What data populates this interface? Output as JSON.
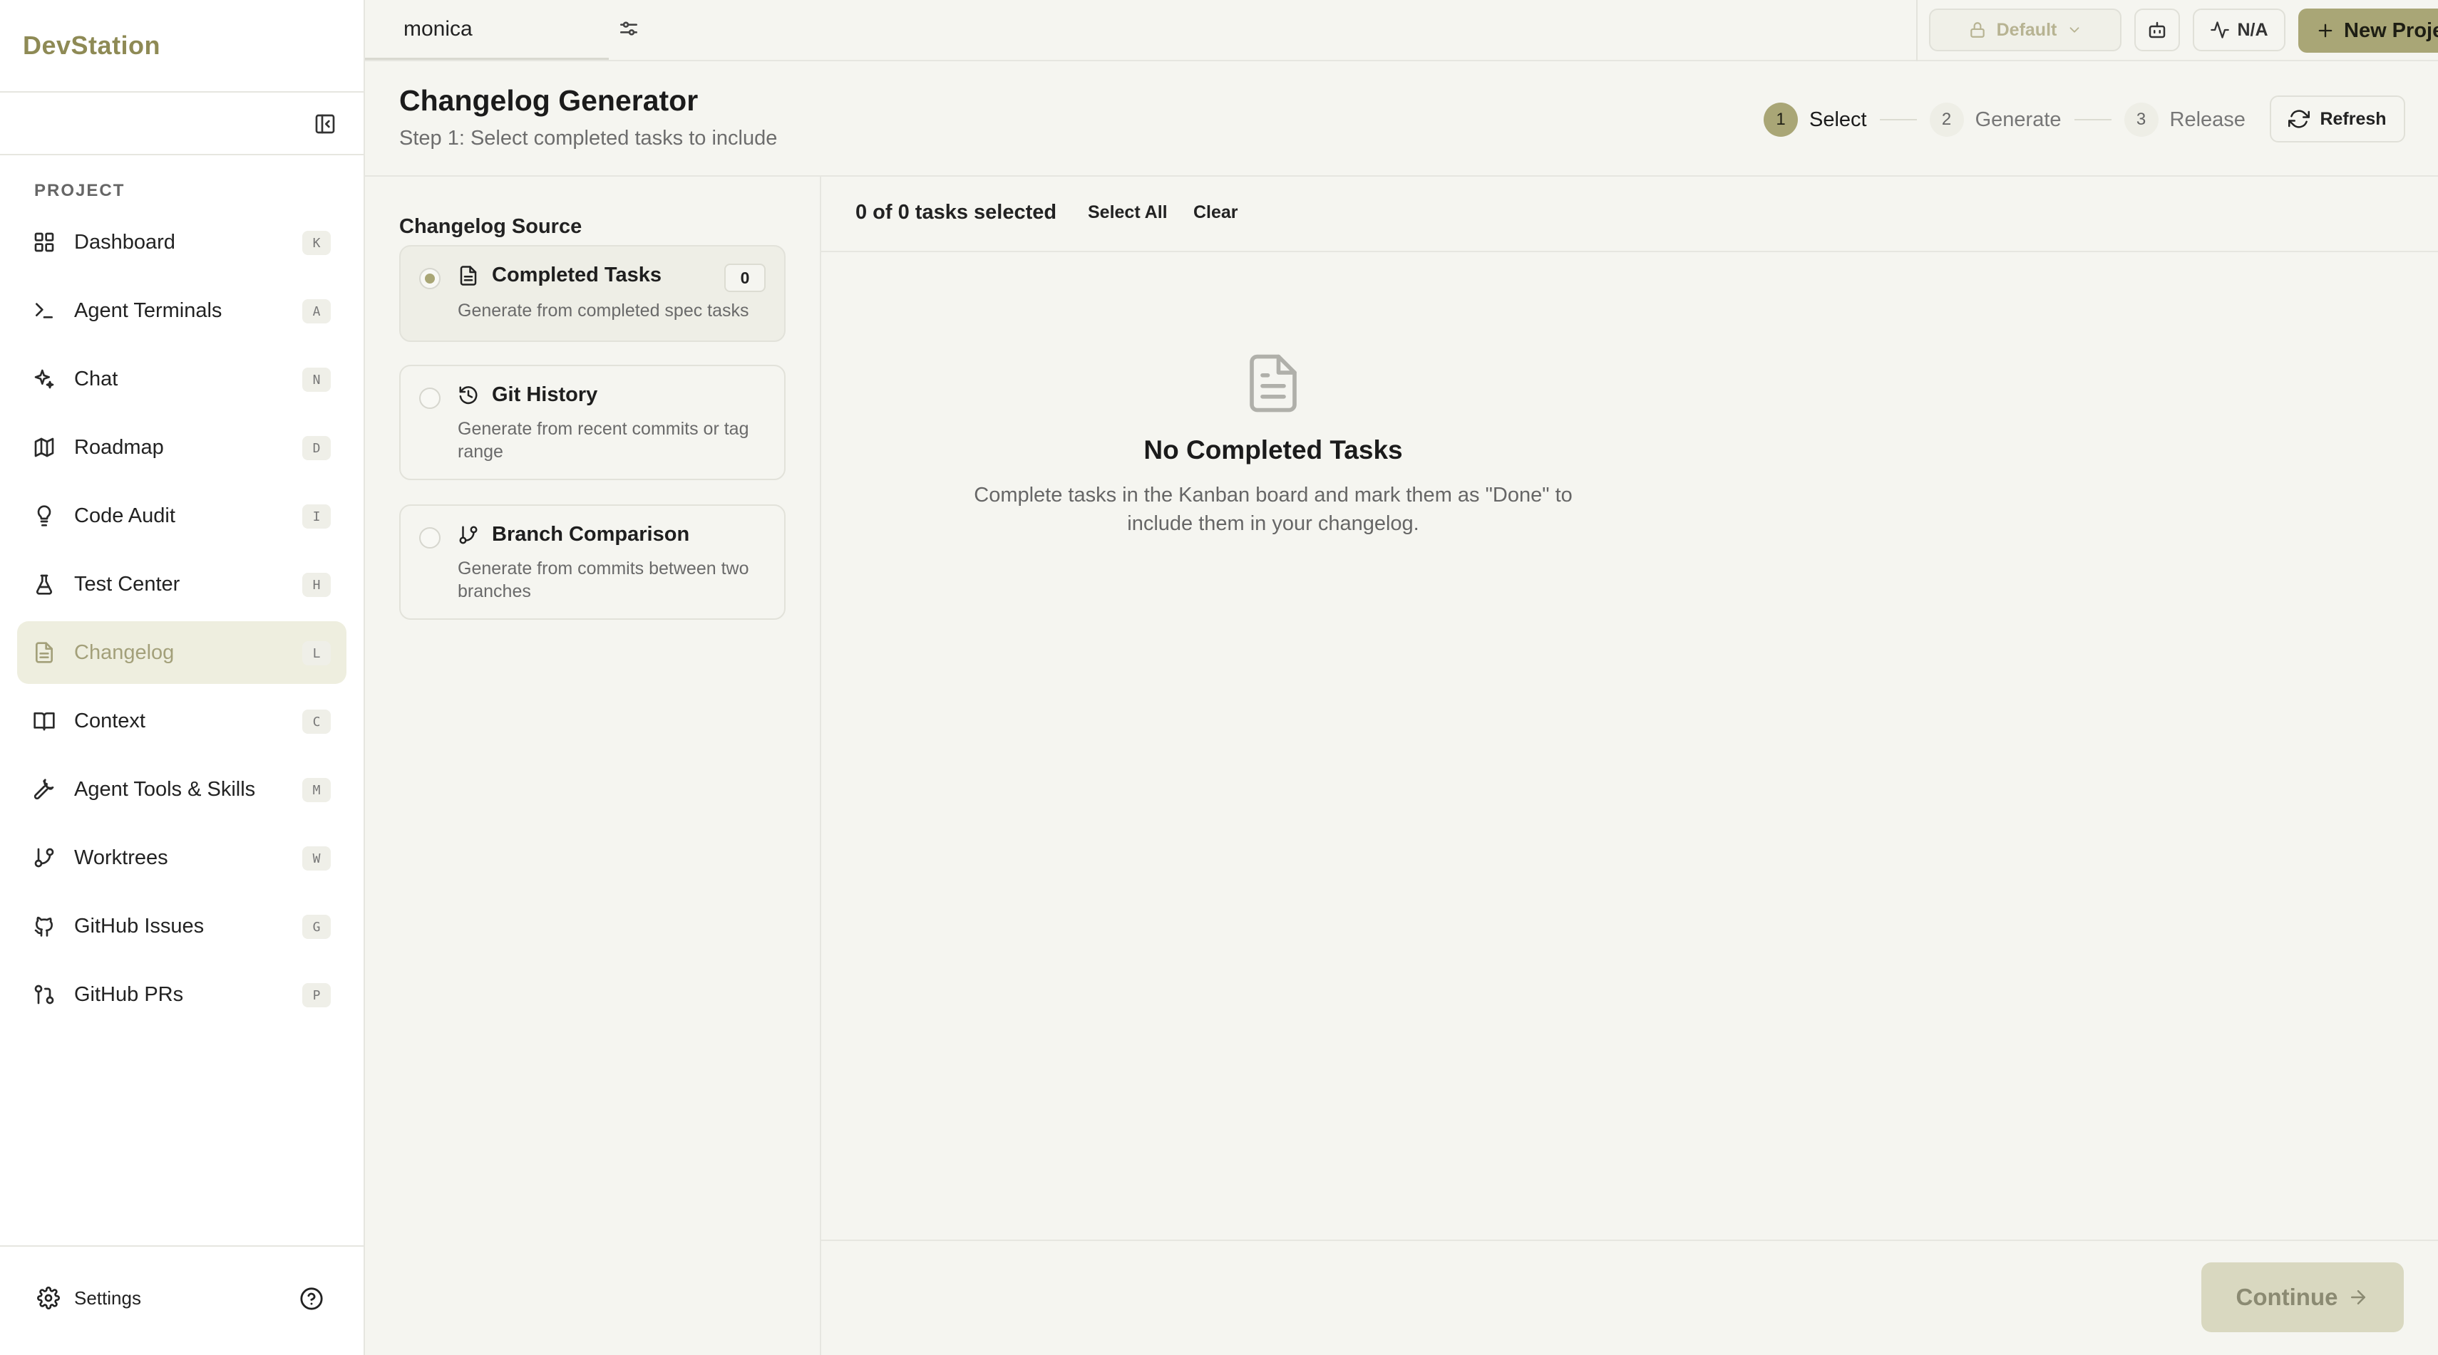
{
  "app": {
    "brand": "DevStation"
  },
  "sidebar": {
    "section_label": "PROJECT",
    "items": [
      {
        "label": "Dashboard",
        "key": "K",
        "icon": "dashboard-icon"
      },
      {
        "label": "Agent Terminals",
        "key": "A",
        "icon": "terminal-icon"
      },
      {
        "label": "Chat",
        "key": "N",
        "icon": "sparkles-icon"
      },
      {
        "label": "Roadmap",
        "key": "D",
        "icon": "map-icon"
      },
      {
        "label": "Code Audit",
        "key": "I",
        "icon": "lightbulb-icon"
      },
      {
        "label": "Test Center",
        "key": "H",
        "icon": "flask-icon"
      },
      {
        "label": "Changelog",
        "key": "L",
        "icon": "file-text-icon",
        "active": true
      },
      {
        "label": "Context",
        "key": "C",
        "icon": "book-open-icon"
      },
      {
        "label": "Agent Tools & Skills",
        "key": "M",
        "icon": "wrench-icon"
      },
      {
        "label": "Worktrees",
        "key": "W",
        "icon": "git-branch-icon"
      },
      {
        "label": "GitHub Issues",
        "key": "G",
        "icon": "github-icon"
      },
      {
        "label": "GitHub PRs",
        "key": "P",
        "icon": "git-pull-request-icon"
      }
    ],
    "settings_label": "Settings"
  },
  "topbar": {
    "project_tab": "monica",
    "profile_label": "Default",
    "status_label": "N/A",
    "new_project_label": "New Project"
  },
  "header": {
    "title": "Changelog Generator",
    "subtitle": "Step 1: Select completed tasks to include",
    "steps": [
      {
        "num": "1",
        "label": "Select",
        "active": true
      },
      {
        "num": "2",
        "label": "Generate",
        "active": false
      },
      {
        "num": "3",
        "label": "Release",
        "active": false
      }
    ],
    "refresh_label": "Refresh"
  },
  "source": {
    "title": "Changelog Source",
    "options": [
      {
        "title": "Completed Tasks",
        "desc": "Generate from completed spec tasks",
        "count": "0",
        "selected": true
      },
      {
        "title": "Git History",
        "desc": "Generate from recent commits or tag range",
        "selected": false
      },
      {
        "title": "Branch Comparison",
        "desc": "Generate from commits between two branches",
        "selected": false
      }
    ]
  },
  "tasks": {
    "selected_count": "0 of 0 tasks selected",
    "select_all_label": "Select All",
    "clear_label": "Clear",
    "empty_title": "No Completed Tasks",
    "empty_desc": "Complete tasks in the Kanban board and mark them as \"Done\" to include them in your changelog.",
    "continue_label": "Continue"
  },
  "colors": {
    "accent": "#a9a676",
    "brand_text": "#8e8a55",
    "active_nav_bg": "#eeeedf",
    "background": "#f5f5f0"
  }
}
